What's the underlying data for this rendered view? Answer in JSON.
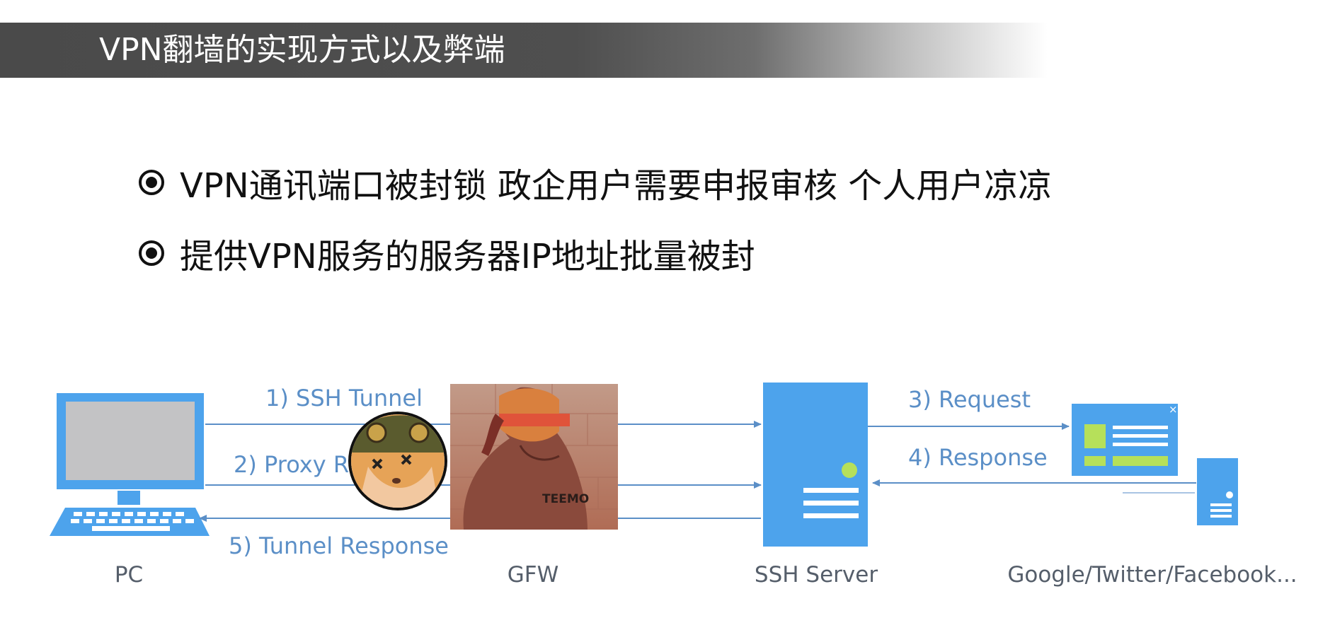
{
  "header": {
    "title": "VPN翻墙的实现方式以及弊端"
  },
  "bullets": [
    {
      "text": "VPN通讯端口被封锁 政企用户需要申报审核 个人用户凉凉"
    },
    {
      "text": "提供VPN服务的服务器IP地址批量被封"
    }
  ],
  "diagram": {
    "nodes": {
      "pc": "PC",
      "gfw": "GFW",
      "ssh_server": "SSH Server",
      "sites": "Google/Twitter/Facebook..."
    },
    "arrows": {
      "ssh_tunnel": "1) SSH Tunnel",
      "proxy": "2) Proxy R",
      "request": "3) Request",
      "response": "4) Response",
      "tunnel_response": "5) Tunnel Response"
    },
    "overlay_text": "TEEMO"
  },
  "colors": {
    "diagram_blue": "#4da3ec",
    "arrow_blue": "#5b8fc7",
    "title_bar": "#4a4a4a"
  }
}
